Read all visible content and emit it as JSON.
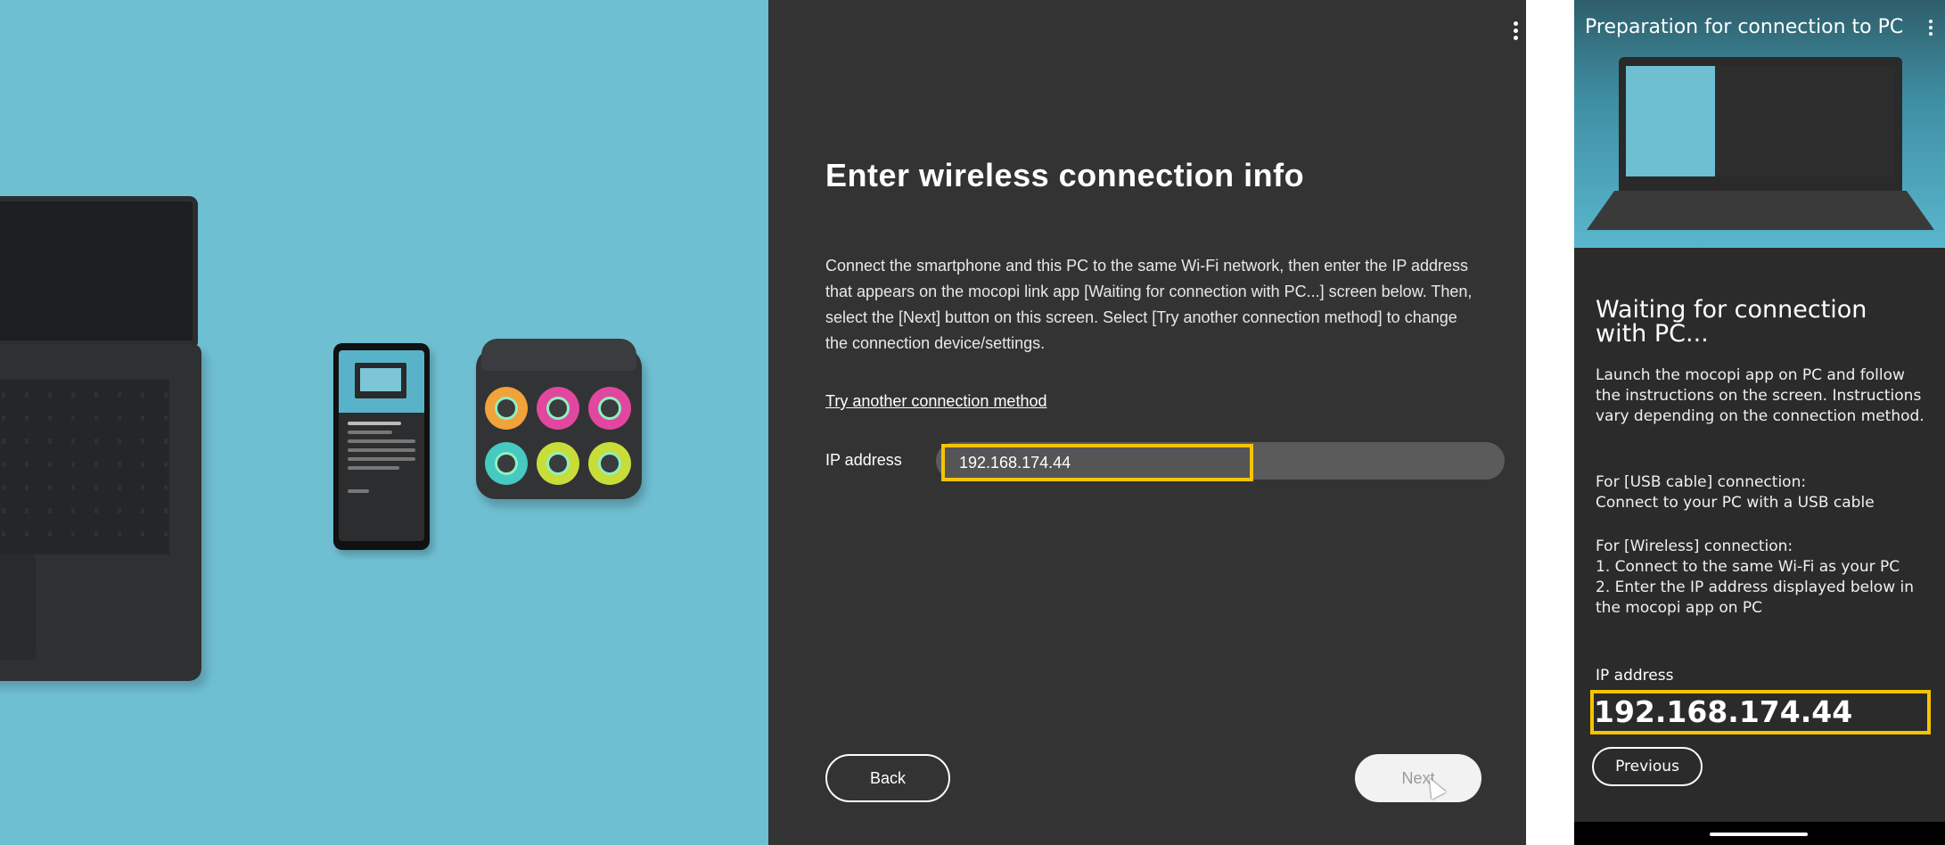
{
  "dialog": {
    "title": "Enter wireless connection info",
    "description": "Connect the smartphone and this PC to the same Wi-Fi network, then enter the IP address that appears on the mocopi link app [Waiting for connection with PC...] screen below. Then, select the [Next] button on this screen. Select [Try another connection method] to change the connection device/settings.",
    "alt_method_link": "Try another connection method",
    "ip_label": "IP address",
    "ip_value": "192.168.174.44",
    "back_label": "Back",
    "next_label": "Next",
    "menu_icon": "more-vert-icon"
  },
  "phone": {
    "title": "Preparation for connection to PC",
    "menu_icon": "more-vert-icon",
    "waiting_title": "Waiting for connection with PC...",
    "instructions": "Launch the mocopi app on PC and follow the instructions on the screen. Instructions vary depending on the connection method.",
    "usb_heading": "For [USB cable] connection:",
    "usb_text": "Connect to your PC with a USB cable",
    "wireless_heading": "For [Wireless] connection:",
    "wireless_step1": "1. Connect to the same Wi-Fi as your PC",
    "wireless_step2": "2. Enter the IP address displayed below in the mocopi app on PC",
    "ip_label": "IP address",
    "ip_value": "192.168.174.44",
    "previous_label": "Previous"
  },
  "colors": {
    "highlight": "#f5c400",
    "illustration_bg": "#6fbfd2",
    "dialog_bg": "#333333"
  }
}
